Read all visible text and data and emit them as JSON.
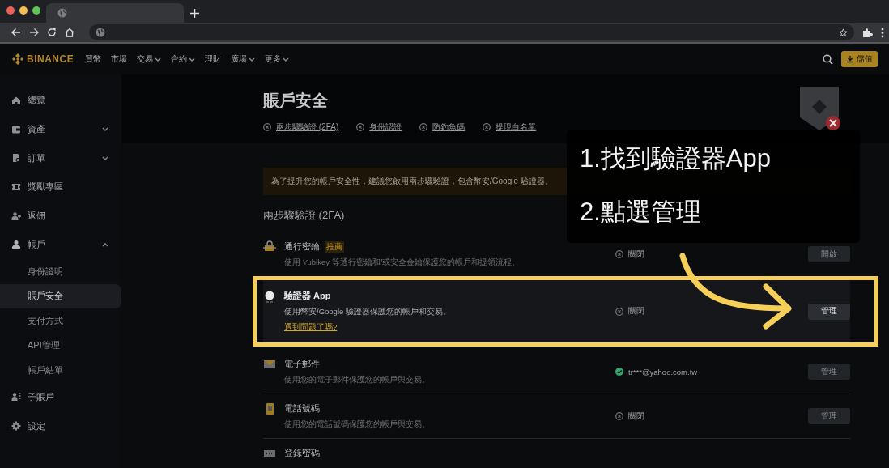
{
  "nav": {
    "logo": "BINANCE",
    "items": [
      {
        "label": "買幣",
        "kind": "link"
      },
      {
        "label": "市場",
        "kind": "link"
      },
      {
        "label": "交易",
        "kind": "menu"
      },
      {
        "label": "合約",
        "kind": "menu"
      },
      {
        "label": "理財",
        "kind": "link"
      },
      {
        "label": "廣場",
        "kind": "menu"
      },
      {
        "label": "更多",
        "kind": "menu"
      }
    ],
    "deposit_button": "儲值"
  },
  "sidebar": {
    "items": [
      {
        "label": "總覽",
        "kind": "link"
      },
      {
        "label": "資產",
        "kind": "group",
        "expanded": false
      },
      {
        "label": "訂單",
        "kind": "group",
        "expanded": false
      },
      {
        "label": "獎勵專區",
        "kind": "link"
      },
      {
        "label": "返佣",
        "kind": "link"
      },
      {
        "label": "帳戶",
        "kind": "group",
        "expanded": true,
        "children": [
          {
            "label": "身份證明",
            "selected": false
          },
          {
            "label": "賬戶安全",
            "selected": true
          },
          {
            "label": "支付方式",
            "selected": false
          },
          {
            "label": "API管理",
            "selected": false
          },
          {
            "label": "帳戶結單",
            "selected": false
          }
        ]
      },
      {
        "label": "子賬戶",
        "kind": "link"
      },
      {
        "label": "設定",
        "kind": "link"
      }
    ]
  },
  "header": {
    "title": "賬戶安全",
    "links": [
      {
        "label": "兩步驟驗證 (2FA)",
        "done": false
      },
      {
        "label": "身份認證",
        "done": false
      },
      {
        "label": "防釣魚碼",
        "done": false
      },
      {
        "label": "提現白名單",
        "done": false
      }
    ]
  },
  "notice": {
    "text": "為了提升您的帳戶安全性，建議您啟用兩步驟驗證，包含幣安/Google 驗證器。"
  },
  "section_title": "兩步驟驗證 (2FA)",
  "methods": [
    {
      "name": "通行密鑰",
      "badge": "推薦",
      "description": "使用 Yubikey 等通行密鑰和/或安全金鑰保護您的帳戶和提領流程。",
      "status": "關閉",
      "enabled": false,
      "button": "開啟",
      "highlighted": false
    },
    {
      "name": "驗證器 App",
      "description": "使用幣安/Google 驗證器保護您的帳戶和交易。",
      "help_link": "遇到問題了嗎?",
      "status": "關閉",
      "enabled": false,
      "button": "管理",
      "highlighted": true
    },
    {
      "name": "電子郵件",
      "description": "使用您的電子郵件保護您的帳戶與交易。",
      "status": "tr***@yahoo.com.tw",
      "enabled": true,
      "button": "管理",
      "highlighted": false
    },
    {
      "name": "電話號碼",
      "description": "使用您的電話號碼保護您的帳戶與交易。",
      "status": "關閉",
      "enabled": false,
      "button": "管理",
      "highlighted": false
    },
    {
      "name": "登錄密碼",
      "highlighted": false
    }
  ],
  "callout": {
    "steps": [
      "1.找到驗證器App",
      "2.點選管理"
    ]
  }
}
